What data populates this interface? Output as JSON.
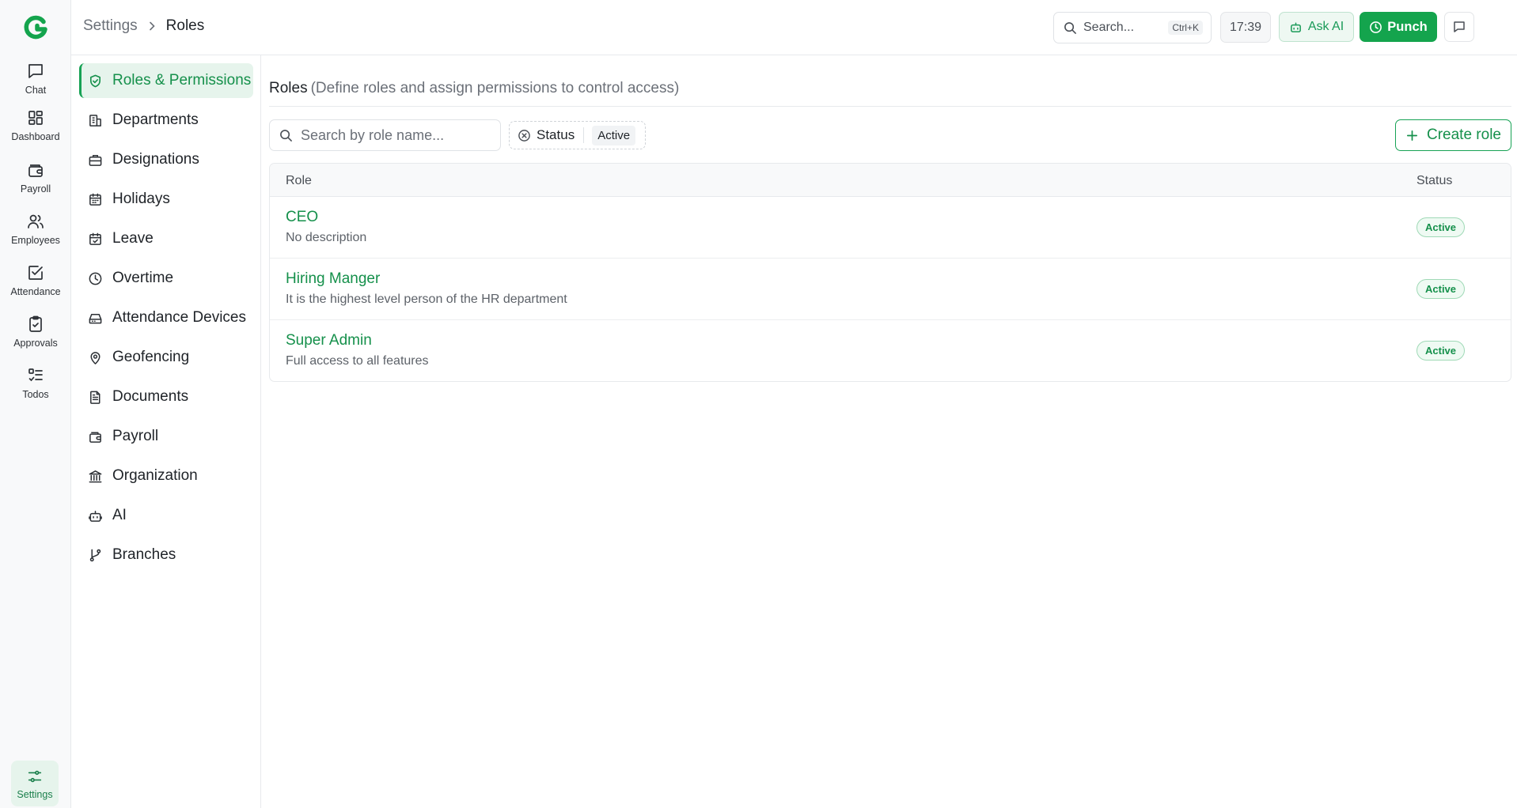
{
  "app": {
    "brand_color": "#14a44d",
    "logo_icon": "app-logo-icon"
  },
  "rail": {
    "items": [
      {
        "label": "Chat",
        "icon": "chat-icon"
      },
      {
        "label": "Dashboard",
        "icon": "dashboard-icon"
      },
      {
        "label": "Payroll",
        "icon": "wallet-icon"
      },
      {
        "label": "Employees",
        "icon": "users-icon"
      },
      {
        "label": "Attendance",
        "icon": "check-square-icon"
      },
      {
        "label": "Approvals",
        "icon": "clipboard-check-icon"
      },
      {
        "label": "Todos",
        "icon": "list-todo-icon"
      }
    ],
    "settings_label": "Settings"
  },
  "header": {
    "breadcrumb": [
      "Settings",
      "Roles"
    ],
    "search_placeholder": "Search...",
    "search_shortcut": "Ctrl+K",
    "time": "17:39",
    "ask_ai_label": "Ask AI",
    "punch_label": "Punch"
  },
  "settings_nav": {
    "active_index": 0,
    "items": [
      {
        "label": "Roles & Permissions",
        "icon": "shield-check-icon"
      },
      {
        "label": "Departments",
        "icon": "building-icon"
      },
      {
        "label": "Designations",
        "icon": "briefcase-icon"
      },
      {
        "label": "Holidays",
        "icon": "calendar-icon"
      },
      {
        "label": "Leave",
        "icon": "calendar-check-icon"
      },
      {
        "label": "Overtime",
        "icon": "clock-icon"
      },
      {
        "label": "Attendance Devices",
        "icon": "device-icon"
      },
      {
        "label": "Geofencing",
        "icon": "map-pin-icon"
      },
      {
        "label": "Documents",
        "icon": "document-icon"
      },
      {
        "label": "Payroll",
        "icon": "wallet-icon"
      },
      {
        "label": "Organization",
        "icon": "landmark-icon"
      },
      {
        "label": "AI",
        "icon": "bot-icon"
      },
      {
        "label": "Branches",
        "icon": "git-branch-icon"
      }
    ]
  },
  "main": {
    "title": "Roles",
    "subtitle": "(Define roles and assign permissions to control access)",
    "search_placeholder": "Search by role name...",
    "filter": {
      "label": "Status",
      "value": "Active"
    },
    "create_label": "Create role",
    "table": {
      "columns": [
        "Role",
        "Status"
      ],
      "rows": [
        {
          "name": "CEO",
          "description": "No description",
          "status": "Active"
        },
        {
          "name": "Hiring Manger",
          "description": "It is the highest level person of the HR department",
          "status": "Active"
        },
        {
          "name": "Super Admin",
          "description": "Full access to all features",
          "status": "Active"
        }
      ]
    }
  }
}
